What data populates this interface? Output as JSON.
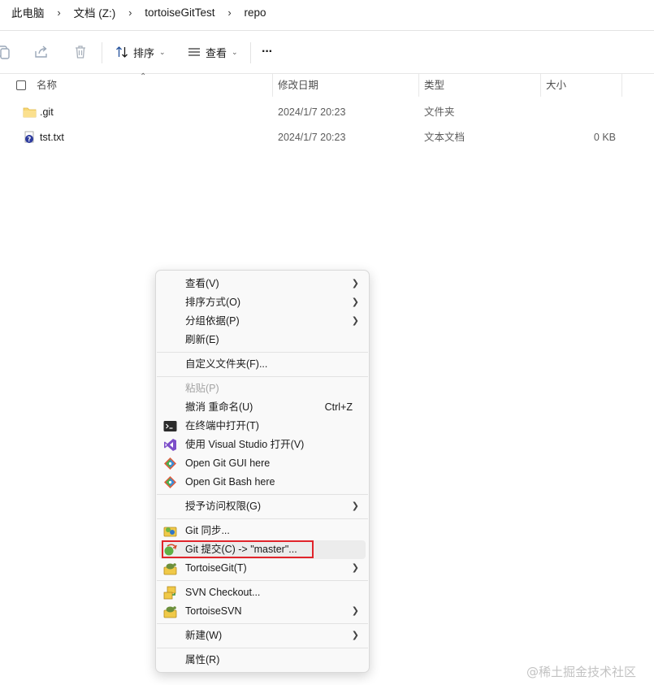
{
  "breadcrumb": {
    "items": [
      "此电脑",
      "文档 (Z:)",
      "tortoiseGitTest",
      "repo"
    ],
    "separator": "›"
  },
  "toolbar": {
    "sort_label": "排序",
    "view_label": "查看",
    "more_label": "···"
  },
  "columns": {
    "name": "名称",
    "modified": "修改日期",
    "type": "类型",
    "size": "大小"
  },
  "files": [
    {
      "name": ".git",
      "modified": "2024/1/7 20:23",
      "type": "文件夹",
      "size": "",
      "icon": "folder-icon"
    },
    {
      "name": "tst.txt",
      "modified": "2024/1/7 20:23",
      "type": "文本文档",
      "size": "0 KB",
      "icon": "text-file-question-icon"
    }
  ],
  "context_menu": {
    "view": "查看(V)",
    "sort_by": "排序方式(O)",
    "group_by": "分组依据(P)",
    "refresh": "刷新(E)",
    "customize_folder": "自定义文件夹(F)...",
    "paste": "粘贴(P)",
    "undo_rename": "撤消 重命名(U)",
    "undo_shortcut": "Ctrl+Z",
    "open_terminal": "在终端中打开(T)",
    "open_vs": "使用 Visual Studio 打开(V)",
    "git_gui": "Open Git GUI here",
    "git_bash": "Open Git Bash here",
    "grant_access": "授予访问权限(G)",
    "git_sync": "Git 同步...",
    "git_commit": "Git 提交(C) -> \"master\"...",
    "tortoisegit": "TortoiseGit(T)",
    "svn_checkout": "SVN Checkout...",
    "tortoisesvn": "TortoiseSVN",
    "new": "新建(W)",
    "properties": "属性(R)"
  },
  "watermark": "@稀土掘金技术社区",
  "colors": {
    "highlight_box": "#e0242b",
    "menu_bg": "#f9f9f9",
    "hover_bg": "#ececec"
  }
}
